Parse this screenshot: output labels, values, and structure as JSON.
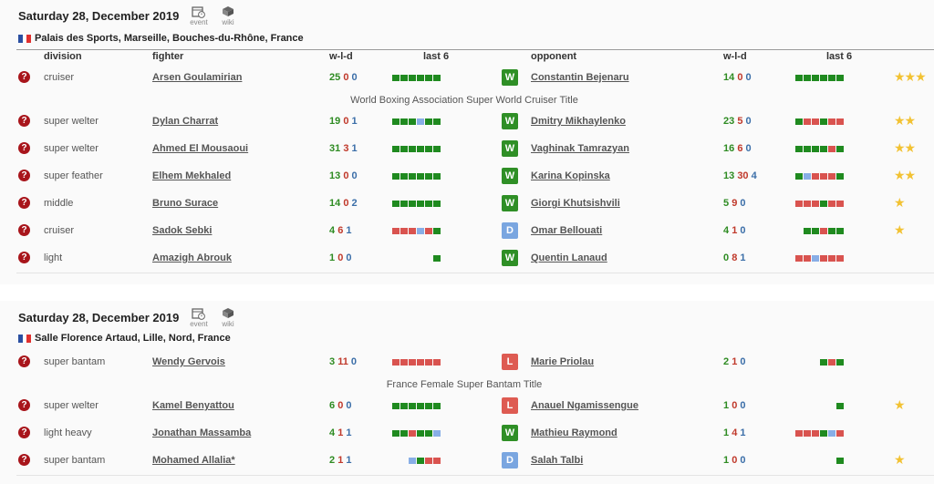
{
  "colors": {
    "win": "#2f8f26",
    "loss": "#de5b52",
    "draw": "#7aa6e0",
    "bar_win": "#1f8a1f",
    "bar_loss": "#d9534f",
    "bar_draw": "#88aee6"
  },
  "events": [
    {
      "date": "Saturday 28, December 2019",
      "event_label": "event",
      "wiki_label": "wiki",
      "venue": "Palais des Sports, Marseille, Bouches-du-Rhône, France",
      "headers": {
        "division": "division",
        "fighter": "fighter",
        "wld": "w-l-d",
        "last6": "last 6",
        "opponent": "opponent",
        "wld2": "w-l-d",
        "last6b": "last 6"
      },
      "bouts": [
        {
          "division": "cruiser",
          "fighter": "Arsen Goulamirian",
          "rec": [
            "25",
            "0",
            "0"
          ],
          "last6": [
            "W",
            "W",
            "W",
            "W",
            "W",
            "W"
          ],
          "result": "W",
          "opponent": "Constantin Bejenaru",
          "orec": [
            "14",
            "0",
            "0"
          ],
          "olast6": [
            "W",
            "W",
            "W",
            "W",
            "W",
            "W"
          ],
          "stars": "★★★",
          "title": "World Boxing Association Super World Cruiser Title"
        },
        {
          "division": "super welter",
          "fighter": "Dylan Charrat",
          "rec": [
            "19",
            "0",
            "1"
          ],
          "last6": [
            "W",
            "W",
            "W",
            "D",
            "W",
            "W"
          ],
          "result": "W",
          "opponent": "Dmitry Mikhaylenko",
          "orec": [
            "23",
            "5",
            "0"
          ],
          "olast6": [
            "W",
            "L",
            "L",
            "W",
            "L",
            "L"
          ],
          "stars": "★★"
        },
        {
          "division": "super welter",
          "fighter": "Ahmed El Mousaoui",
          "rec": [
            "31",
            "3",
            "1"
          ],
          "last6": [
            "W",
            "W",
            "W",
            "W",
            "W",
            "W"
          ],
          "result": "W",
          "opponent": "Vaghinak Tamrazyan",
          "orec": [
            "16",
            "6",
            "0"
          ],
          "olast6": [
            "W",
            "W",
            "W",
            "W",
            "L",
            "W"
          ],
          "stars": "★★"
        },
        {
          "division": "super feather",
          "fighter": "Elhem Mekhaled",
          "rec": [
            "13",
            "0",
            "0"
          ],
          "last6": [
            "W",
            "W",
            "W",
            "W",
            "W",
            "W"
          ],
          "result": "W",
          "opponent": "Karina Kopinska",
          "orec": [
            "13",
            "30",
            "4"
          ],
          "olast6": [
            "W",
            "D",
            "L",
            "L",
            "L",
            "W"
          ],
          "stars": "★★"
        },
        {
          "division": "middle",
          "fighter": "Bruno Surace",
          "rec": [
            "14",
            "0",
            "2"
          ],
          "last6": [
            "W",
            "W",
            "W",
            "W",
            "W",
            "W"
          ],
          "result": "W",
          "opponent": "Giorgi Khutsishvili",
          "orec": [
            "5",
            "9",
            "0"
          ],
          "olast6": [
            "L",
            "L",
            "L",
            "W",
            "L",
            "L"
          ],
          "stars": "★"
        },
        {
          "division": "cruiser",
          "fighter": "Sadok Sebki",
          "rec": [
            "4",
            "6",
            "1"
          ],
          "last6": [
            "L",
            "L",
            "L",
            "D",
            "L",
            "W"
          ],
          "result": "D",
          "opponent": "Omar Bellouati",
          "orec": [
            "4",
            "1",
            "0"
          ],
          "olast6": [
            "W",
            "W",
            "L",
            "W",
            "W"
          ],
          "stars": "★"
        },
        {
          "division": "light",
          "fighter": "Amazigh Abrouk",
          "rec": [
            "1",
            "0",
            "0"
          ],
          "last6": [
            "W"
          ],
          "result": "W",
          "opponent": "Quentin Lanaud",
          "orec": [
            "0",
            "8",
            "1"
          ],
          "olast6": [
            "L",
            "L",
            "D",
            "L",
            "L",
            "L"
          ],
          "stars": ""
        }
      ]
    },
    {
      "date": "Saturday 28, December 2019",
      "event_label": "event",
      "wiki_label": "wiki",
      "venue": "Salle Florence Artaud, Lille, Nord, France",
      "bouts": [
        {
          "division": "super bantam",
          "fighter": "Wendy Gervois",
          "rec": [
            "3",
            "11",
            "0"
          ],
          "last6": [
            "L",
            "L",
            "L",
            "L",
            "L",
            "L"
          ],
          "result": "L",
          "opponent": "Marie Priolau",
          "orec": [
            "2",
            "1",
            "0"
          ],
          "olast6": [
            "W",
            "L",
            "W"
          ],
          "stars": "",
          "title": "France Female Super Bantam Title"
        },
        {
          "division": "super welter",
          "fighter": "Kamel Benyattou",
          "rec": [
            "6",
            "0",
            "0"
          ],
          "last6": [
            "W",
            "W",
            "W",
            "W",
            "W",
            "W"
          ],
          "result": "L",
          "opponent": "Anauel Ngamissengue",
          "orec": [
            "1",
            "0",
            "0"
          ],
          "olast6": [
            "W"
          ],
          "stars": "★"
        },
        {
          "division": "light heavy",
          "fighter": "Jonathan Massamba",
          "rec": [
            "4",
            "1",
            "1"
          ],
          "last6": [
            "W",
            "W",
            "L",
            "W",
            "W",
            "D"
          ],
          "result": "W",
          "opponent": "Mathieu Raymond",
          "orec": [
            "1",
            "4",
            "1"
          ],
          "olast6": [
            "L",
            "L",
            "L",
            "W",
            "D",
            "L"
          ],
          "stars": ""
        },
        {
          "division": "super bantam",
          "fighter": "Mohamed Allalia*",
          "rec": [
            "2",
            "1",
            "1"
          ],
          "last6": [
            "D",
            "W",
            "L",
            "L"
          ],
          "result": "D",
          "opponent": "Salah Talbi",
          "orec": [
            "1",
            "0",
            "0"
          ],
          "olast6": [
            "W"
          ],
          "stars": "★"
        }
      ]
    }
  ]
}
